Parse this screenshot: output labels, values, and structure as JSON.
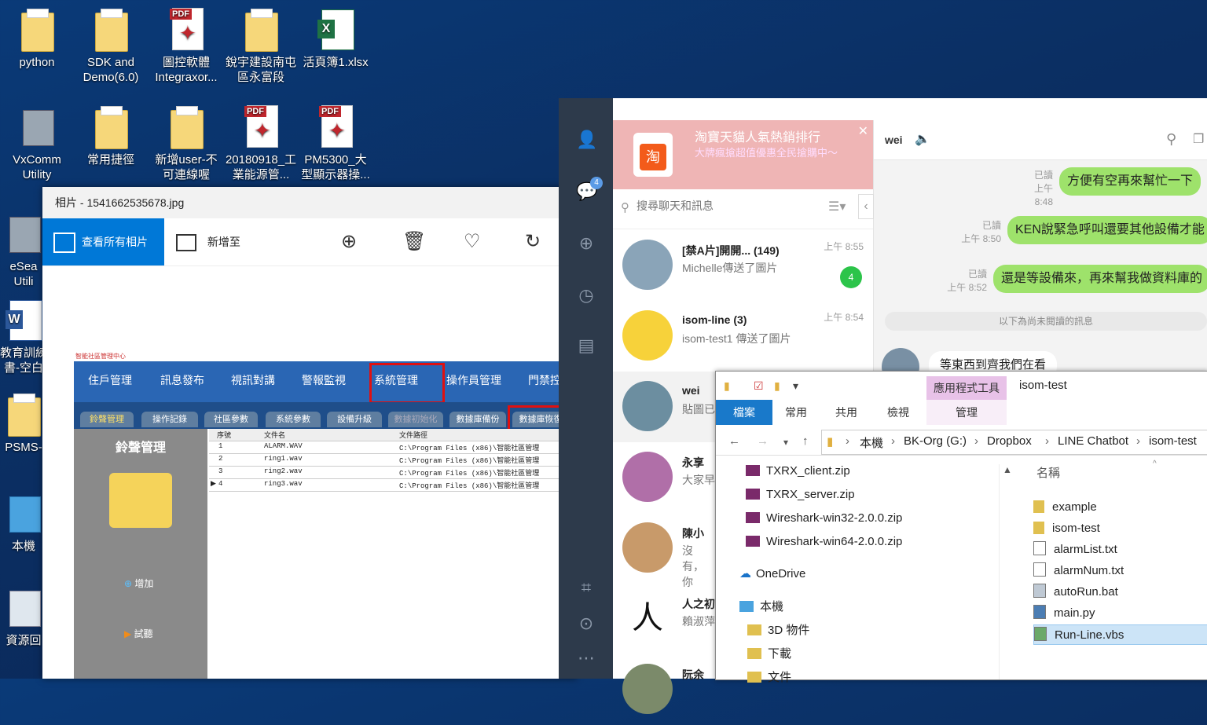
{
  "desktop": {
    "icons": [
      {
        "label": "python"
      },
      {
        "label": "SDK and Demo(6.0)"
      },
      {
        "label": "圖控軟體 Integraxor..."
      },
      {
        "label": "銳宇建設南屯區永富段"
      },
      {
        "label": "活頁簿1.xlsx"
      },
      {
        "label": "VxComm Utility"
      },
      {
        "label": "常用捷徑"
      },
      {
        "label": "新增user-不可連線喔"
      },
      {
        "label": "20180918_工業能源管..."
      },
      {
        "label": "PM5300_大型顯示器操..."
      },
      {
        "label": "eSea Utili"
      },
      {
        "label": "教育訓練書-空白"
      },
      {
        "label": "PSMS-"
      },
      {
        "label": "本機"
      },
      {
        "label": "資源回"
      }
    ]
  },
  "photos": {
    "title": "相片 - 1541662535678.jpg",
    "view_all": "查看所有相片",
    "add_to": "新增至",
    "inner": {
      "header_text": "智能社區管理中心",
      "menu": [
        "住戶管理",
        "訊息發布",
        "視訊對講",
        "警報監視",
        "系統管理",
        "操作員管理",
        "門禁控"
      ],
      "subtabs": [
        "鈴聲管理",
        "操作記錄",
        "社區參數",
        "系統參數",
        "設備升級",
        "數據初始化",
        "數據庫備份",
        "數據庫恢復"
      ],
      "side_title": "鈴聲管理",
      "add_btn": "增加",
      "test_btn": "試聽",
      "columns": [
        "序號",
        "文件名",
        "文件路徑"
      ],
      "rows": [
        [
          "1",
          "ALARM.WAV",
          "C:\\Program Files (x86)\\智能社區管理"
        ],
        [
          "2",
          "ring1.wav",
          "C:\\Program Files (x86)\\智能社區管理"
        ],
        [
          "3",
          "ring2.wav",
          "C:\\Program Files (x86)\\智能社區管理"
        ],
        [
          "4",
          "ring3.wav",
          "C:\\Program Files (x86)\\智能社區管理"
        ]
      ]
    }
  },
  "line": {
    "badge_count": "4",
    "ad": {
      "title": "淘寶天貓人氣熱銷排行",
      "desc": "大牌瘋搶超值優惠全民搶購中～",
      "logo": "淘"
    },
    "search_placeholder": "搜尋聊天和訊息",
    "chats": [
      {
        "name": "[禁A片]開開... (149)",
        "msg": "Michelle傳送了圖片",
        "time": "上午 8:55",
        "unread": "4"
      },
      {
        "name": "isom-line (3)",
        "msg": "isom-test1 傳送了圖片",
        "time": "上午 8:54"
      },
      {
        "name": "wei",
        "msg": "貼圖已"
      },
      {
        "name": "永享",
        "msg": "大家早"
      },
      {
        "name": "陳小",
        "msg": "沒有，你"
      },
      {
        "name": "人之初",
        "msg": "賴淑萍"
      },
      {
        "name": "阮余"
      }
    ],
    "conversation": {
      "title": "wei",
      "messages": [
        {
          "read": "已讀",
          "time": "上午 8:48",
          "text": "方便有空再來幫忙一下"
        },
        {
          "read": "已讀",
          "time": "上午 8:50",
          "text": "KEN說緊急呼叫還要其他設備才能"
        },
        {
          "read": "已讀",
          "time": "上午 8:52",
          "text": "還是等設備來，再來幫我做資料庫的"
        }
      ],
      "unread_divider": "以下為尚未閱讀的訊息",
      "incoming": "等東西到齊我們在看"
    }
  },
  "explorer": {
    "title": "isom-test",
    "app_tools": "應用程式工具",
    "tabs": [
      "檔案",
      "常用",
      "共用",
      "檢視",
      "管理"
    ],
    "breadcrumb": [
      "本機",
      "BK-Org (G:)",
      "Dropbox",
      "LINE Chatbot",
      "isom-test"
    ],
    "nav_items": [
      "TXRX_client.zip",
      "TXRX_server.zip",
      "Wireshark-win32-2.0.0.zip",
      "Wireshark-win64-2.0.0.zip",
      "OneDrive",
      "本機",
      "3D 物件",
      "下載",
      "文件"
    ],
    "column_name": "名稱",
    "files": [
      "example",
      "isom-test",
      "alarmList.txt",
      "alarmNum.txt",
      "autoRun.bat",
      "main.py",
      "Run-Line.vbs"
    ]
  }
}
